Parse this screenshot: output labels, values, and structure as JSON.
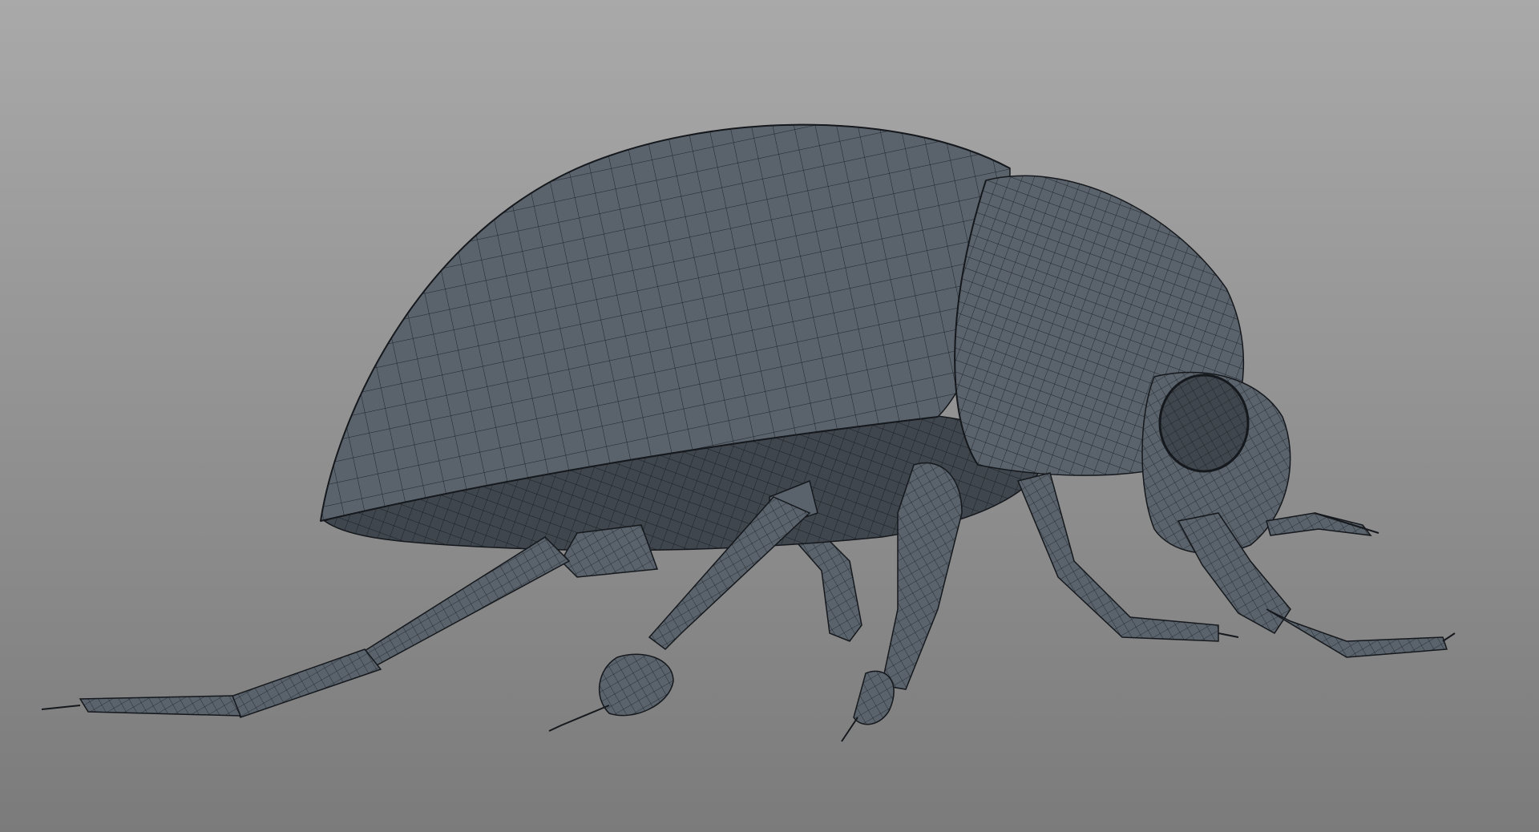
{
  "viewport": {
    "background_top": "#a9a9a9",
    "background_bottom": "#7b7b7b"
  },
  "model": {
    "subject": "beetle-wireframe-mesh",
    "display_mode": "wireframe-on-shaded",
    "shaded_color": "#5a636c",
    "shadow_color": "#3f464d",
    "wire_color": "#15181c",
    "legs": 6,
    "antennae": 2
  }
}
